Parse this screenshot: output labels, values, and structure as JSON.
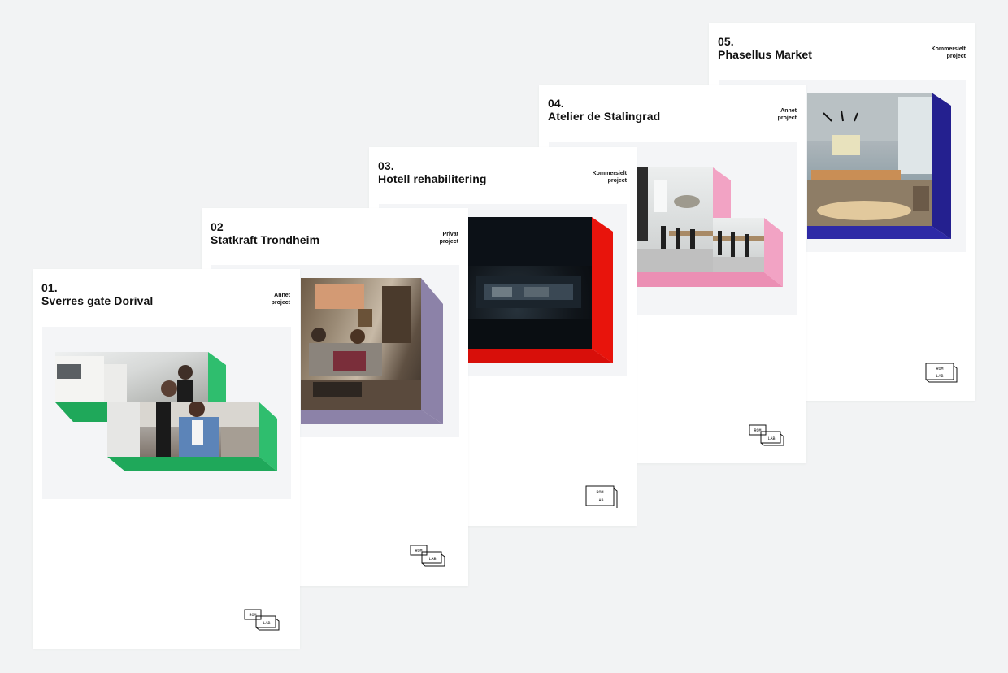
{
  "background": "#f2f3f4",
  "brand": {
    "logo_top": "ROM",
    "logo_bottom": "LAB"
  },
  "cards": [
    {
      "num": "01.",
      "title": "Sverres gate Dorival",
      "tag_line1": "Annet",
      "tag_line2": "project",
      "accent": "#2fbe6e"
    },
    {
      "num": "02",
      "title": "Statkraft Trondheim",
      "tag_line1": "Privat",
      "tag_line2": "project",
      "accent": "#8c82a8"
    },
    {
      "num": "03.",
      "title": "Hotell rehabilitering",
      "tag_line1": "Kommersielt",
      "tag_line2": "project",
      "accent": "#e8140c"
    },
    {
      "num": "04.",
      "title": "Atelier de Stalingrad",
      "tag_line1": "Annet",
      "tag_line2": "project",
      "accent": "#f2a3c4"
    },
    {
      "num": "05.",
      "title": "Phasellus Market",
      "tag_line1": "Kommersielt",
      "tag_line2": "project",
      "accent": "#24208f"
    }
  ]
}
